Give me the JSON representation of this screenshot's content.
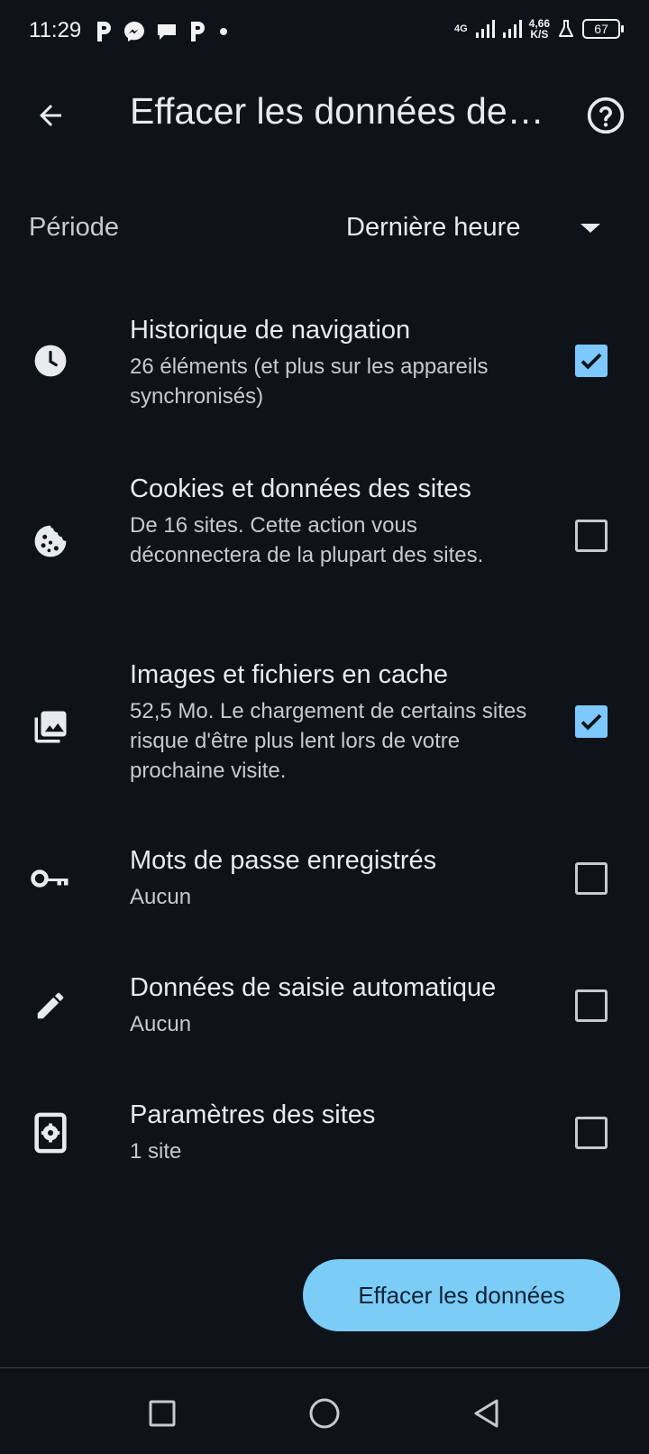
{
  "status_bar": {
    "time": "11:29",
    "network_type": "4G",
    "speed_value": "4,66",
    "speed_unit": "K/S",
    "battery": "67",
    "notification_icons": [
      "p-app-icon",
      "messenger-icon",
      "chat-bubble-icon",
      "p-app-icon",
      "more-dot-icon"
    ]
  },
  "header": {
    "title": "Effacer les données de navigation",
    "back_icon": "arrow-back-icon",
    "help_icon": "help-circle-icon"
  },
  "period": {
    "label": "Période",
    "value": "Dernière heure"
  },
  "items": [
    {
      "icon": "clock-icon",
      "title": "Historique de navigation",
      "description": "26 éléments (et plus sur les appareils synchronisés)",
      "checked": true
    },
    {
      "icon": "cookie-icon",
      "title": "Cookies et données des sites",
      "description": "De 16 sites. Cette action vous déconnectera de la plupart des sites.",
      "checked": false
    },
    {
      "icon": "image-library-icon",
      "title": "Images et fichiers en cache",
      "description": "52,5 Mo. Le chargement de certains sites risque d'être plus lent lors de votre prochaine visite.",
      "checked": true
    },
    {
      "icon": "key-icon",
      "title": "Mots de passe enregistrés",
      "description": "Aucun",
      "checked": false
    },
    {
      "icon": "pencil-icon",
      "title": "Données de saisie automatique",
      "description": "Aucun",
      "checked": false
    },
    {
      "icon": "site-settings-icon",
      "title": "Paramètres des sites",
      "description": "1 site",
      "checked": false
    }
  ],
  "actions": {
    "clear_label": "Effacer les données"
  },
  "colors": {
    "background": "#0e131a",
    "accent": "#7cc8ff",
    "text_primary": "#e8eaee",
    "text_secondary": "#c6c9d0"
  }
}
